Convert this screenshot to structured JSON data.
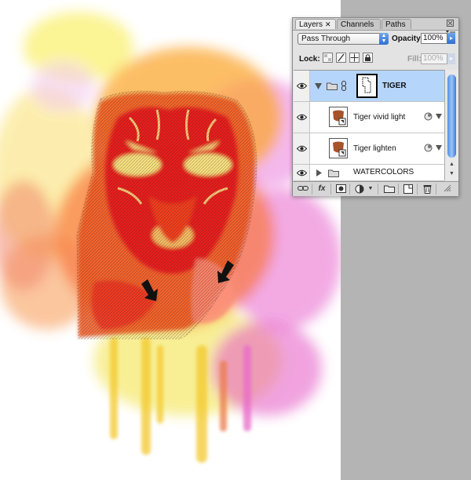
{
  "panel": {
    "tabs": [
      {
        "label": "Layers",
        "active": true
      },
      {
        "label": "Channels",
        "active": false
      },
      {
        "label": "Paths",
        "active": false
      }
    ],
    "close_glyph": "✕",
    "blend_mode": "Pass Through",
    "opacity_label": "Opacity:",
    "opacity_value": "100%",
    "lock_label": "Lock:",
    "fill_label": "Fill:",
    "fill_value": "100%"
  },
  "layers": [
    {
      "name": "TIGER",
      "type": "group",
      "expanded": true,
      "selected": true,
      "visible": true
    },
    {
      "name": "Tiger vivid light",
      "type": "layer",
      "visible": true
    },
    {
      "name": "Tiger lighten",
      "type": "layer",
      "visible": true
    },
    {
      "name": "WATERCOLORS",
      "type": "group",
      "expanded": false,
      "visible": true
    }
  ],
  "colors": {
    "selection": "#b5d5fb",
    "accent_blue": "#2f6fd0",
    "tiger_red": "#e8141e",
    "watercolor_pink": "#e64fc6",
    "watercolor_yellow": "#f7e216"
  },
  "icons": {
    "eye": "eye-icon",
    "folder": "folder-icon",
    "link": "link-icon",
    "fx": "fx-icon",
    "mask": "mask-icon",
    "adjustment": "adjustment-icon",
    "new_group": "new-group-icon",
    "new_layer": "new-layer-icon",
    "trash": "trash-icon"
  }
}
